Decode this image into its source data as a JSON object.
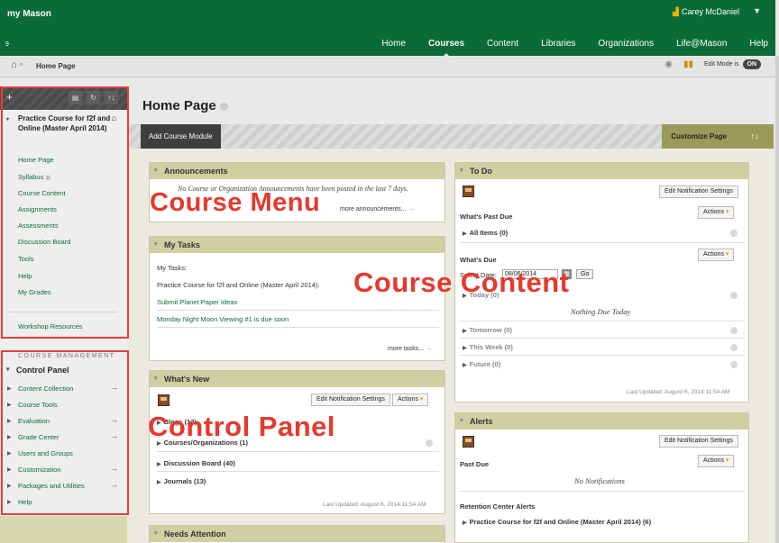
{
  "header": {
    "logo": "my Mason",
    "user": "Carey McDaniel",
    "chevron": "▼",
    "nav": [
      "Home",
      "Courses",
      "Content",
      "Libraries",
      "Organizations",
      "Life@Mason",
      "Help"
    ]
  },
  "breadcrumb": {
    "page": "Home Page",
    "edit_mode_label": "Edit Mode is",
    "edit_mode_value": "ON"
  },
  "sidebar": {
    "course_title": "Practice Course for f2f and Online (Master April 2014)",
    "items": [
      "Home Page",
      "Syllabus",
      "Course Content",
      "Assignments",
      "Assessments",
      "Discussion Board",
      "Tools",
      "Help",
      "My Grades"
    ],
    "extra_item": "Workshop Resources",
    "management_label": "COURSE MANAGEMENT",
    "control_panel": "Control Panel",
    "cm_items": [
      "Content Collection",
      "Course Tools",
      "Evaluation",
      "Grade Center",
      "Users and Groups",
      "Customization",
      "Packages and Utilities",
      "Help"
    ]
  },
  "page": {
    "title": "Home Page",
    "add_module": "Add Course Module",
    "customize": "Customize Page",
    "sort_icon": "↑↓"
  },
  "announcements": {
    "title": "Announcements",
    "empty": "No Course or Organization Announcements have been posted in the last 7 days.",
    "more": "more announcements..."
  },
  "tasks": {
    "title": "My Tasks",
    "label": "My Tasks:",
    "course": "Practice Course for f2f and Online (Master April 2014):",
    "items": [
      "Submit Planet Paper Ideas",
      "Monday Night Moon Viewing #1 is due soon"
    ],
    "more": "more tasks..."
  },
  "whatsnew": {
    "title": "What's New",
    "notif": "Edit Notification Settings",
    "actions": "Actions",
    "rows": [
      "Blogs (12)",
      "Courses/Organizations (1)",
      "Discussion Board (40)",
      "Journals (13)"
    ],
    "updated": "Last Updated: August 6, 2014 11:54 AM"
  },
  "needs": {
    "title": "Needs Attention"
  },
  "todo": {
    "title": "To Do",
    "notif": "Edit Notification Settings",
    "actions": "Actions",
    "past_due": "What's Past Due",
    "all_items": "All Items (0)",
    "due": "What's Due",
    "select_date": "Select Date:",
    "date": "08/06/2014",
    "go": "Go",
    "today": "Today (0)",
    "nothing": "Nothing Due Today",
    "tomorrow": "Tomorrow (0)",
    "this_week": "This Week (0)",
    "future": "Future (0)",
    "updated": "Last Updated: August 6, 2014 11:54 AM"
  },
  "alerts": {
    "title": "Alerts",
    "notif": "Edit Notification Settings",
    "actions": "Actions",
    "past_due": "Past Due",
    "none": "No Notifications",
    "retention": "Retention Center Alerts",
    "course_row": "Practice Course for f2f and Online (Master April 2014) (6)"
  },
  "annotations": {
    "course_menu": "Course Menu",
    "course_content": "Course Content",
    "control_panel": "Control Panel"
  },
  "colors": {
    "brand_green": "#0a6b38",
    "module_header": "#cfcfa2",
    "annotation_red": "#e5392e"
  }
}
